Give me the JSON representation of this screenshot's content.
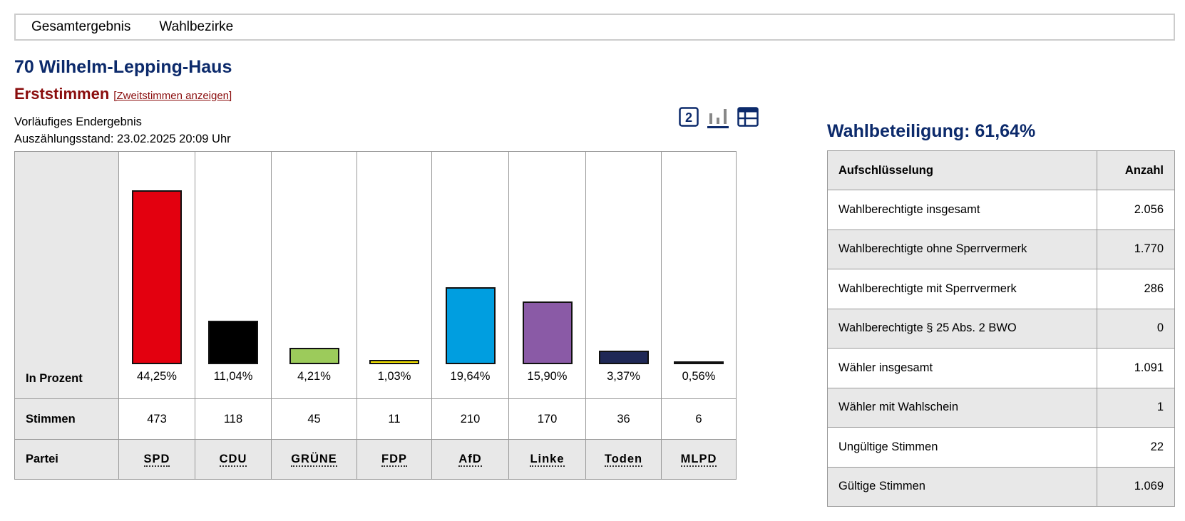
{
  "nav": [
    "Gesamtergebnis",
    "Wahlbezirke"
  ],
  "title": "70 Wilhelm-Lepping-Haus",
  "subtitle": {
    "label": "Erststimmen",
    "link": "[Zweitstimmen anzeigen]"
  },
  "status": {
    "line1": "Vorläufiges Endergebnis",
    "line2": "Auszählungsstand: 23.02.2025 20:09 Uhr"
  },
  "icons": [
    "number-2-icon",
    "bar-chart-icon",
    "table-icon"
  ],
  "turnout": "Wahlbeteiligung: 61,64%",
  "chart_data": {
    "type": "bar",
    "row_labels": {
      "percent": "In Prozent",
      "votes": "Stimmen",
      "party": "Partei"
    },
    "categories": [
      "SPD",
      "CDU",
      "GRÜNE",
      "FDP",
      "AfD",
      "Linke",
      "Toden",
      "MLPD"
    ],
    "values": [
      44.25,
      11.04,
      4.21,
      1.03,
      19.64,
      15.9,
      3.37,
      0.56
    ],
    "percent_labels": [
      "44,25%",
      "11,04%",
      "4,21%",
      "1,03%",
      "19,64%",
      "15,90%",
      "3,37%",
      "0,56%"
    ],
    "votes": [
      "473",
      "118",
      "45",
      "11",
      "210",
      "170",
      "36",
      "6"
    ],
    "colors": [
      "#e3000f",
      "#000000",
      "#9ccb5b",
      "#ffed00",
      "#009ee0",
      "#8a5aa6",
      "#1f2856",
      "#000000"
    ],
    "ylim": [
      0,
      44.25
    ]
  },
  "breakdown": {
    "headers": [
      "Aufschlüsselung",
      "Anzahl"
    ],
    "rows": [
      [
        "Wahlberechtigte insgesamt",
        "2.056"
      ],
      [
        "Wahlberechtigte ohne Sperrvermerk",
        "1.770"
      ],
      [
        "Wahlberechtigte mit Sperrvermerk",
        "286"
      ],
      [
        "Wahlberechtigte § 25 Abs. 2 BWO",
        "0"
      ],
      [
        "Wähler insgesamt",
        "1.091"
      ],
      [
        "Wähler mit Wahlschein",
        "1"
      ],
      [
        "Ungültige Stimmen",
        "22"
      ],
      [
        "Gültige Stimmen",
        "1.069"
      ]
    ]
  }
}
